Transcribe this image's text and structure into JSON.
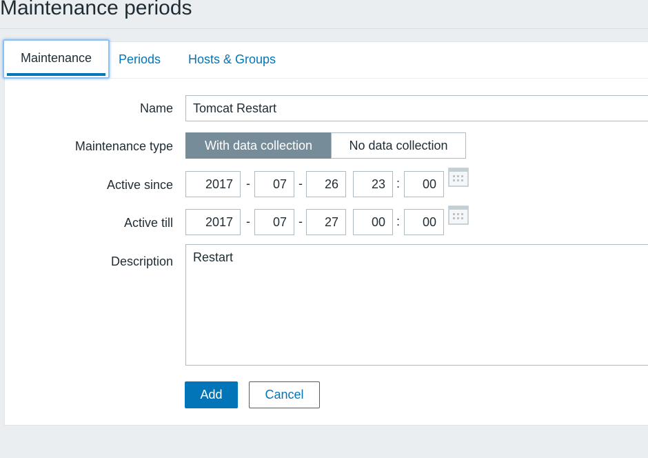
{
  "page": {
    "title": "Maintenance periods"
  },
  "tabs": [
    {
      "label": "Maintenance",
      "active": true
    },
    {
      "label": "Periods",
      "active": false
    },
    {
      "label": "Hosts & Groups",
      "active": false
    }
  ],
  "form": {
    "name": {
      "label": "Name",
      "value": "Tomcat Restart"
    },
    "maintenance_type": {
      "label": "Maintenance type",
      "options": [
        "With data collection",
        "No data collection"
      ],
      "selected": "With data collection"
    },
    "active_since": {
      "label": "Active since",
      "year": "2017",
      "month": "07",
      "day": "26",
      "hour": "23",
      "minute": "00",
      "date_sep": "-",
      "time_sep": ":"
    },
    "active_till": {
      "label": "Active till",
      "year": "2017",
      "month": "07",
      "day": "27",
      "hour": "00",
      "minute": "00",
      "date_sep": "-",
      "time_sep": ":"
    },
    "description": {
      "label": "Description",
      "value": "Restart"
    }
  },
  "buttons": {
    "add": "Add",
    "cancel": "Cancel"
  },
  "icons": {
    "calendar": "calendar-icon"
  },
  "colors": {
    "accent": "#0275b8",
    "segment_selected": "#768d99",
    "tab_focus": "#8dc1f5",
    "page_bg": "#ebeef0"
  }
}
